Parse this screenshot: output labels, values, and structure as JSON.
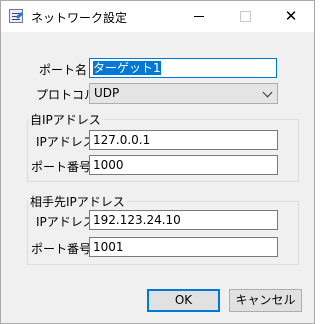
{
  "window": {
    "title": "ネットワーク設定",
    "min_icon": "minimize-icon",
    "max_icon": "maximize-icon",
    "close_icon": "close-icon",
    "close_glyph": "✕"
  },
  "form": {
    "port_name_label": "ポート名",
    "port_name_value": "ターゲット1",
    "protocol_label": "プロトコル",
    "protocol_value": "UDP"
  },
  "local": {
    "group_title": "自IPアドレス",
    "ip_label": "IPアドレス",
    "ip_value": "127.0.0.1",
    "port_label": "ポート番号",
    "port_value": "1000"
  },
  "remote": {
    "group_title": "相手先IPアドレス",
    "ip_label": "IPアドレス",
    "ip_value": "192.123.24.10",
    "port_label": "ポート番号",
    "port_value": "1001"
  },
  "buttons": {
    "ok_label": "OK",
    "cancel_label": "キャンセル"
  },
  "colors": {
    "selection": "#0078d7",
    "focus_border": "#0078d7",
    "dialog_bg": "#f0f0f0"
  }
}
